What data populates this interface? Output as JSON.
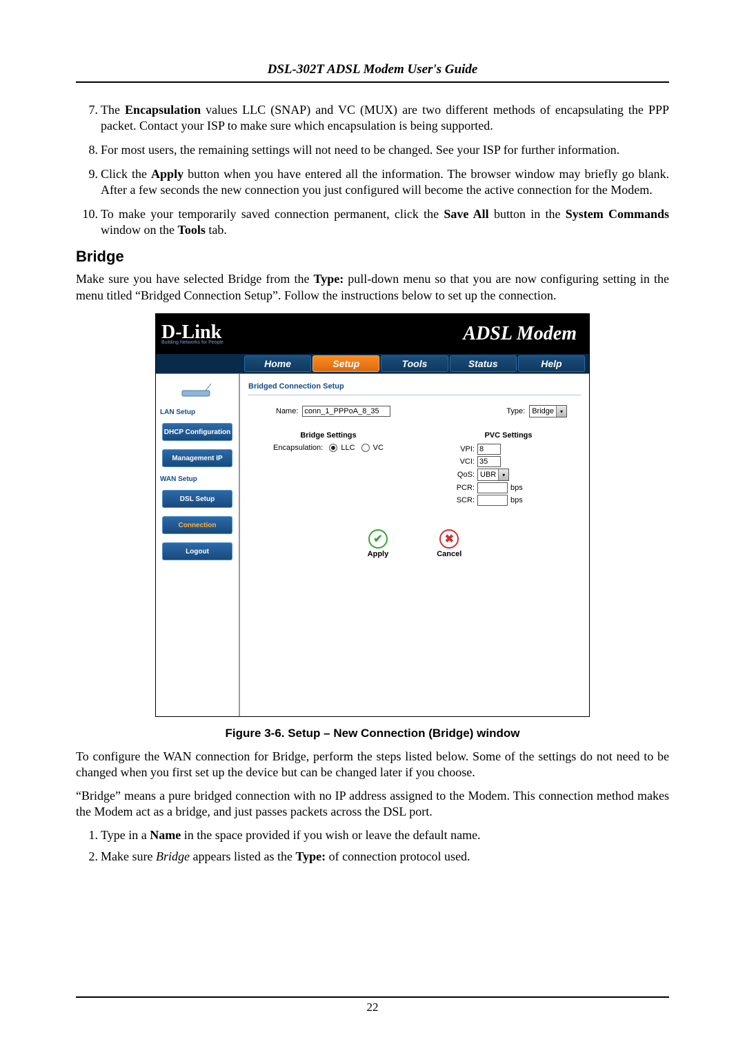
{
  "doc": {
    "title": "DSL-302T ADSL Modem User's Guide",
    "page_number": "22"
  },
  "list_top": [
    "The **Encapsulation** values LLC (SNAP) and VC (MUX) are two different methods of encapsulating the PPP packet. Contact your ISP to make sure which encapsulation is being supported.",
    "For most users, the remaining settings will not need to be changed. See your ISP for further information.",
    "Click the **Apply** button when you have entered all the information. The browser window may briefly go blank. After a few seconds the new connection you just configured will become the active connection for the Modem.",
    "To make your temporarily saved connection permanent, click the **Save All** button in the **System Commands** window on the **Tools** tab."
  ],
  "section": {
    "heading": "Bridge",
    "p1_a": "Make sure you have selected Bridge from the ",
    "p1_b": "Type:",
    "p1_c": " pull-down menu so that you are now configuring setting in the menu titled “Bridged Connection Setup”. Follow the instructions below to set up the connection."
  },
  "ui": {
    "brand": "D-Link",
    "brand_sub": "Building Networks for People",
    "product": "ADSL Modem",
    "tabs": [
      "Home",
      "Setup",
      "Tools",
      "Status",
      "Help"
    ],
    "active_tab_index": 1,
    "sidebar": {
      "group1_label": "LAN Setup",
      "btn_dhcp": "DHCP Configuration",
      "btn_mgmt": "Management IP",
      "group2_label": "WAN Setup",
      "btn_dsl": "DSL Setup",
      "btn_conn": "Connection",
      "btn_logout": "Logout"
    },
    "panel": {
      "title": "Bridged Connection Setup",
      "name_label": "Name:",
      "name_value": "conn_1_PPPoA_8_35",
      "type_label": "Type:",
      "type_value": "Bridge",
      "bridge_heading": "Bridge Settings",
      "encaps_label": "Encapsulation:",
      "encaps_opt_llc": "LLC",
      "encaps_opt_vc": "VC",
      "encaps_selected": "LLC",
      "pvc_heading": "PVC Settings",
      "vpi_label": "VPI:",
      "vpi_value": "8",
      "vci_label": "VCI:",
      "vci_value": "35",
      "qos_label": "QoS:",
      "qos_value": "UBR",
      "pcr_label": "PCR:",
      "pcr_value": "",
      "scr_label": "SCR:",
      "scr_value": "",
      "rate_unit": "bps",
      "apply_label": "Apply",
      "cancel_label": "Cancel"
    }
  },
  "figure_caption": "Figure 3-6. Setup – New Connection (Bridge) window",
  "para_after_a": "To configure the WAN connection for Bridge, perform the steps listed below. Some of the settings do not need to be changed when you first set up the device but can be changed later if you choose.",
  "para_after_b": "“Bridge” means a pure bridged connection with no IP address assigned to the Modem. This connection method makes the Modem act as a bridge, and just passes packets across the DSL port.",
  "steps_bottom": {
    "s1_a": "Type in a ",
    "s1_b": "Name",
    "s1_c": " in the space provided if you wish or leave the default name.",
    "s2_a": "Make sure ",
    "s2_b": "Bridge",
    "s2_c": " appears listed as the ",
    "s2_d": "Type:",
    "s2_e": " of connection protocol used."
  }
}
